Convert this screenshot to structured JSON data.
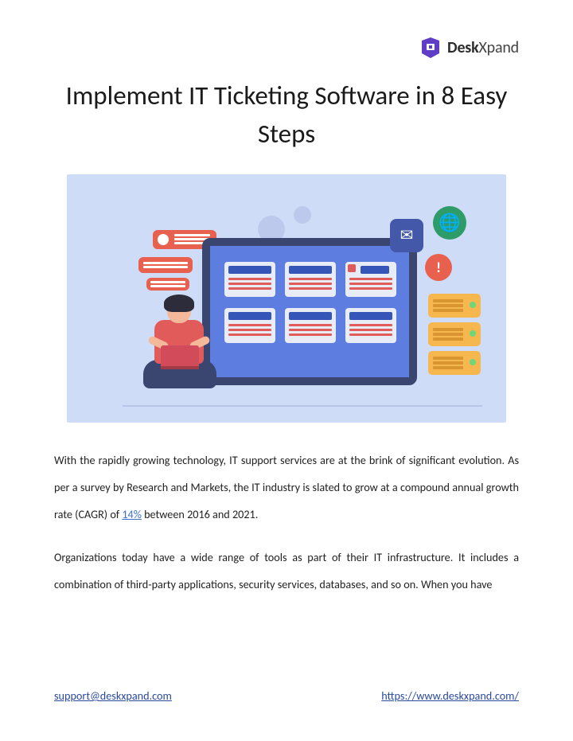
{
  "brand": {
    "name_bold": "Desk",
    "name_light": "Xpand"
  },
  "title": "Implement IT Ticketing Software in 8 Easy Steps",
  "body": {
    "p1_a": "With the rapidly growing technology, IT support services are at the brink of significant evolution. As per a survey by Research and Markets, the IT industry is slated to grow at a compound annual growth rate (CAGR) of ",
    "p1_link": "14%",
    "p1_b": " between 2016 and 2021.",
    "p2": "Organizations today have a wide range of tools as part of their IT infrastructure. It includes a combination of third-party applications, security services, databases, and so on. When you have"
  },
  "icons": {
    "mail": "✉",
    "globe": "🌐",
    "alert": "!"
  },
  "footer": {
    "email": "support@deskxpand.com",
    "url": "https://www.deskxpand.com/"
  }
}
